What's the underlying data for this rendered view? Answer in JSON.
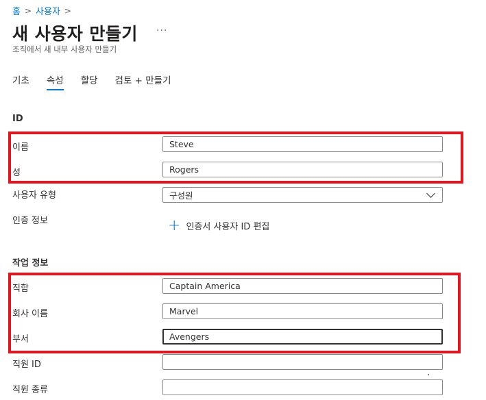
{
  "breadcrumb": {
    "home": "홈",
    "users": "사용자"
  },
  "header": {
    "title": "새 사용자 만들기",
    "more": "···",
    "subtitle": "조직에서 새 내부 사용자 만들기"
  },
  "tabs": [
    {
      "label": "기초",
      "active": false
    },
    {
      "label": "속성",
      "active": true
    },
    {
      "label": "할당",
      "active": false
    },
    {
      "label": "검토 + 만들기",
      "active": false
    }
  ],
  "identity": {
    "heading": "ID",
    "first_name_label": "이름",
    "first_name_value": "Steve",
    "last_name_label": "성",
    "last_name_value": "Rogers",
    "user_type_label": "사용자 유형",
    "user_type_value": "구성원",
    "auth_label": "인증 정보",
    "auth_link": "인증서 사용자 ID 편집"
  },
  "job": {
    "heading": "작업 정보",
    "job_title_label": "직함",
    "job_title_value": "Captain America",
    "company_label": "회사 이름",
    "company_value": "Marvel",
    "department_label": "부서",
    "department_value": "Avengers",
    "employee_id_label": "직원 ID",
    "employee_id_value": "",
    "employee_type_label": "직원 종류",
    "employee_type_value": ""
  },
  "colors": {
    "accent": "#0078d4",
    "highlight": "#e3161f"
  }
}
